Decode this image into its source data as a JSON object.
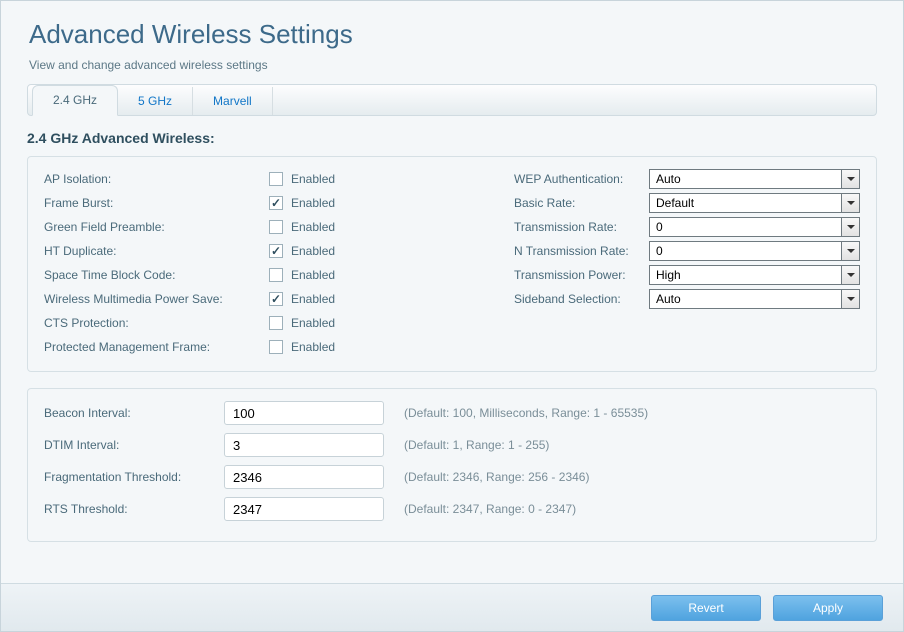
{
  "header": {
    "title": "Advanced Wireless Settings",
    "subtitle": "View and change advanced wireless settings"
  },
  "tabs": {
    "items": [
      {
        "label": "2.4 GHz",
        "active": true
      },
      {
        "label": "5 GHz",
        "active": false
      },
      {
        "label": "Marvell",
        "active": false
      }
    ]
  },
  "section_title": "2.4 GHz Advanced Wireless:",
  "checkbox_enabled_label": "Enabled",
  "left_options": [
    {
      "name": "ap-isolation",
      "label": "AP Isolation:",
      "checked": false
    },
    {
      "name": "frame-burst",
      "label": "Frame Burst:",
      "checked": true
    },
    {
      "name": "green-field-preamble",
      "label": "Green Field Preamble:",
      "checked": false
    },
    {
      "name": "ht-duplicate",
      "label": "HT Duplicate:",
      "checked": true
    },
    {
      "name": "space-time-block-code",
      "label": "Space Time Block Code:",
      "checked": false
    },
    {
      "name": "wireless-multimedia-power-save",
      "label": "Wireless Multimedia Power Save:",
      "checked": true
    },
    {
      "name": "cts-protection",
      "label": "CTS Protection:",
      "checked": false
    },
    {
      "name": "protected-management-frame",
      "label": "Protected Management Frame:",
      "checked": false
    }
  ],
  "right_selects": [
    {
      "name": "wep-authentication",
      "label": "WEP Authentication:",
      "value": "Auto"
    },
    {
      "name": "basic-rate",
      "label": "Basic Rate:",
      "value": "Default"
    },
    {
      "name": "transmission-rate",
      "label": "Transmission Rate:",
      "value": "0"
    },
    {
      "name": "n-transmission-rate",
      "label": "N Transmission Rate:",
      "value": "0"
    },
    {
      "name": "transmission-power",
      "label": "Transmission Power:",
      "value": "High"
    },
    {
      "name": "sideband-selection",
      "label": "Sideband Selection:",
      "value": "Auto"
    }
  ],
  "bottom_fields": [
    {
      "name": "beacon-interval",
      "label": "Beacon Interval:",
      "value": "100",
      "hint": "(Default: 100, Milliseconds, Range: 1 - 65535)"
    },
    {
      "name": "dtim-interval",
      "label": "DTIM Interval:",
      "value": "3",
      "hint": "(Default: 1, Range: 1 - 255)"
    },
    {
      "name": "fragmentation-threshold",
      "label": "Fragmentation Threshold:",
      "value": "2346",
      "hint": "(Default: 2346, Range: 256 - 2346)"
    },
    {
      "name": "rts-threshold",
      "label": "RTS Threshold:",
      "value": "2347",
      "hint": "(Default: 2347, Range: 0 - 2347)"
    }
  ],
  "footer": {
    "revert": "Revert",
    "apply": "Apply"
  }
}
